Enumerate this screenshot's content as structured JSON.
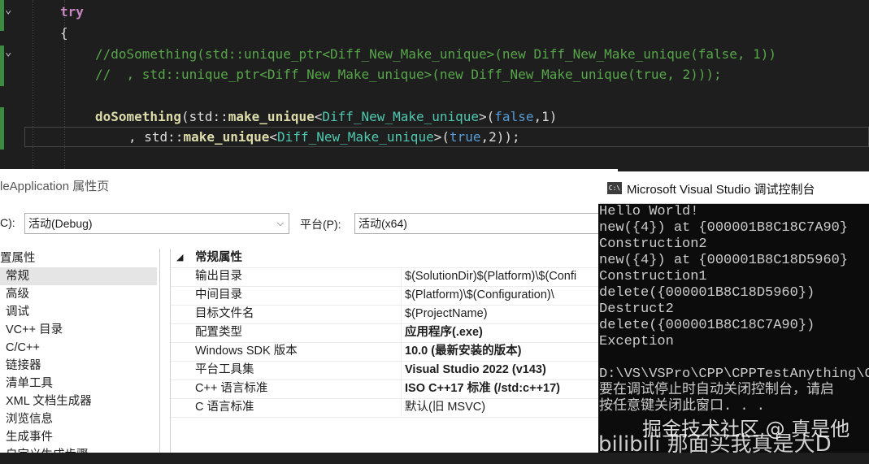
{
  "editor": {
    "lines": {
      "try_kw": "try",
      "open_brace": "{",
      "c1": "//doSomething(std::unique_ptr<Diff_New_Make_unique>(new Diff_New_Make_unique(false, 1))",
      "c2": "//  , std::unique_ptr<Diff_New_Make_unique>(new Diff_New_Make_unique(true, 2)));",
      "l5_fn": "doSomething",
      "l5_a": "(std::",
      "l5_mu": "make_unique",
      "l5_lt": "<",
      "l5_ty": "Diff_New_Make_unique",
      "l5_b": ">(",
      "l5_false": "false",
      "l5_c": ",1)",
      "l6_a": ", std::",
      "l6_mu": "make_unique",
      "l6_lt": "<",
      "l6_ty": "Diff_New_Make_unique",
      "l6_b": ">(",
      "l6_true": "true",
      "l6_c": ",2));"
    },
    "fold_glyph": "⌄"
  },
  "property_page": {
    "title": "leApplication 属性页",
    "config_label": "C):",
    "config_value": "活动(Debug)",
    "platform_label": "平台(P):",
    "platform_value": "活动(x64)",
    "tree": [
      "置属性",
      "常规",
      "高级",
      "调试",
      "VC++ 目录",
      "C/C++",
      "链接器",
      "清单工具",
      "XML 文档生成器",
      "浏览信息",
      "生成事件",
      "自定义生成步骤"
    ],
    "grid_category": "常规属性",
    "rows": [
      {
        "name": "输出目录",
        "value": "$(SolutionDir)$(Platform)\\$(Confi",
        "bold": false
      },
      {
        "name": "中间目录",
        "value": "$(Platform)\\$(Configuration)\\",
        "bold": false
      },
      {
        "name": "目标文件名",
        "value": "$(ProjectName)",
        "bold": false
      },
      {
        "name": "配置类型",
        "value": "应用程序(.exe)",
        "bold": true
      },
      {
        "name": "Windows SDK 版本",
        "value": "10.0 (最新安装的版本)",
        "bold": true
      },
      {
        "name": "平台工具集",
        "value": "Visual Studio 2022 (v143)",
        "bold": true
      },
      {
        "name": "C++ 语言标准",
        "value": "ISO C++17 标准 (/std:c++17)",
        "bold": true
      },
      {
        "name": "C 语言标准",
        "value": "默认(旧 MSVC)",
        "bold": false
      }
    ]
  },
  "console": {
    "title": "Microsoft Visual Studio 调试控制台",
    "icon_text": "C:\\",
    "lines": [
      "Hello World!",
      "new({4}) at {000001B8C18C7A90}",
      "Construction2",
      "new({4}) at {000001B8C18D5960}",
      "Construction1",
      "delete({000001B8C18D5960})",
      "Destruct2",
      "delete({000001B8C18C7A90})",
      "Exception",
      "",
      "D:\\VS\\VSPro\\CPP\\CPPTestAnything\\C",
      "要在调试停止时自动关闭控制台，请启",
      "按任意键关闭此窗口. . ."
    ]
  },
  "watermark": {
    "line1": "掘金技术社区 @ 真是他",
    "line2": "bilibili  那面买我真是大D"
  }
}
